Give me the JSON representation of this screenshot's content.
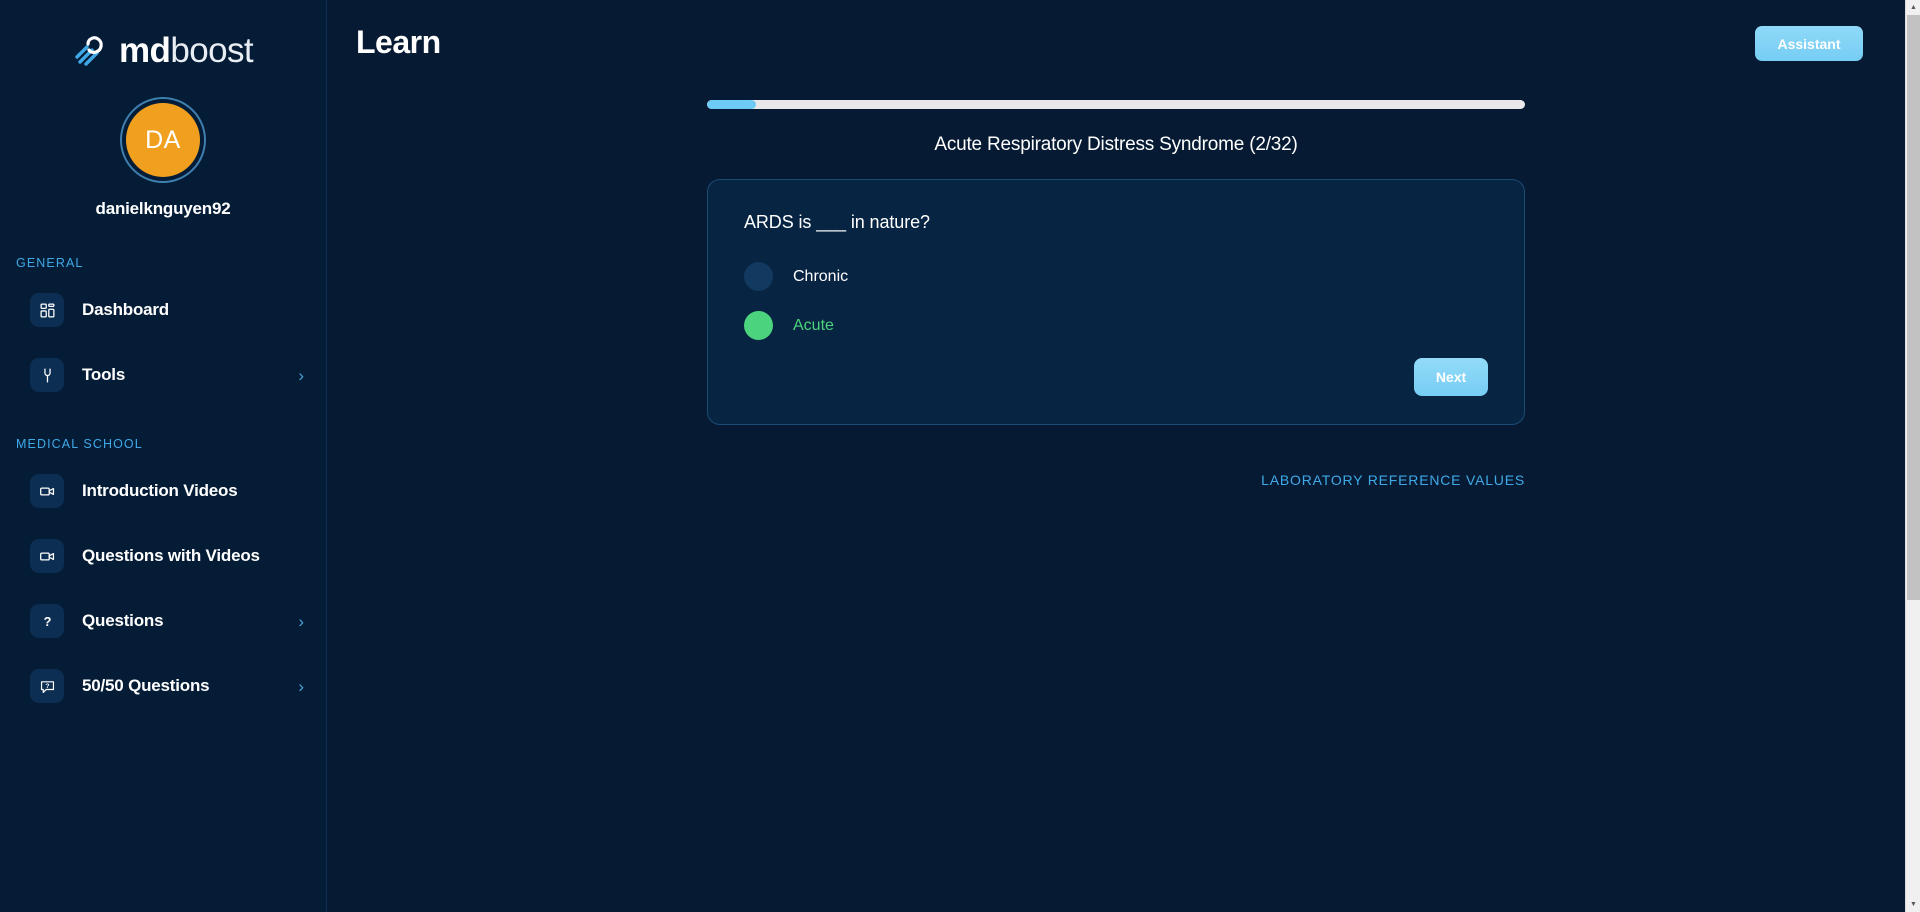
{
  "brand": {
    "name_bold": "md",
    "name_light": "boost",
    "logo_icon": "mdboost-logo-icon"
  },
  "user": {
    "initials": "DA",
    "username": "danielknguyen92",
    "avatar_color": "#f0a01e",
    "ring_color": "#3f7fae"
  },
  "sidebar": {
    "sections": [
      {
        "label": "GENERAL",
        "items": [
          {
            "label": "Dashboard",
            "icon": "grid-icon",
            "chevron": ""
          },
          {
            "label": "Tools",
            "icon": "wrench-icon",
            "chevron": "›"
          }
        ]
      },
      {
        "label": "MEDICAL SCHOOL",
        "items": [
          {
            "label": "Introduction Videos",
            "icon": "video-camera-icon",
            "chevron": ""
          },
          {
            "label": "Questions with Videos",
            "icon": "video-camera-icon",
            "chevron": ""
          },
          {
            "label": "Questions",
            "icon": "question-mark-icon",
            "chevron": "›"
          },
          {
            "label": "50/50 Questions",
            "icon": "chat-question-icon",
            "chevron": "›"
          }
        ]
      }
    ]
  },
  "header": {
    "title": "Learn",
    "assistant_label": "Assistant"
  },
  "quiz": {
    "progress_percent": 6,
    "title": "Acute Respiratory Distress Syndrome (2/32)",
    "current_index": 2,
    "total": 32,
    "question": "ARDS is ___ in nature?",
    "options": [
      {
        "label": "Chronic",
        "state": "unselected"
      },
      {
        "label": "Acute",
        "state": "correct"
      }
    ],
    "next_label": "Next",
    "lab_link_label": "LABORATORY REFERENCE VALUES"
  },
  "colors": {
    "page_bg": "#061b33",
    "sidebar_bg": "#051c36",
    "card_bg": "#072442",
    "card_border": "#1b4a73",
    "accent_blue": "#3fa9e8",
    "button_blue": "#76cdf4",
    "correct_green": "#4bd47d",
    "progress_track": "#e8e8ea"
  },
  "scrollbar": {
    "up_arrow": "▲",
    "down_arrow": "▼"
  }
}
